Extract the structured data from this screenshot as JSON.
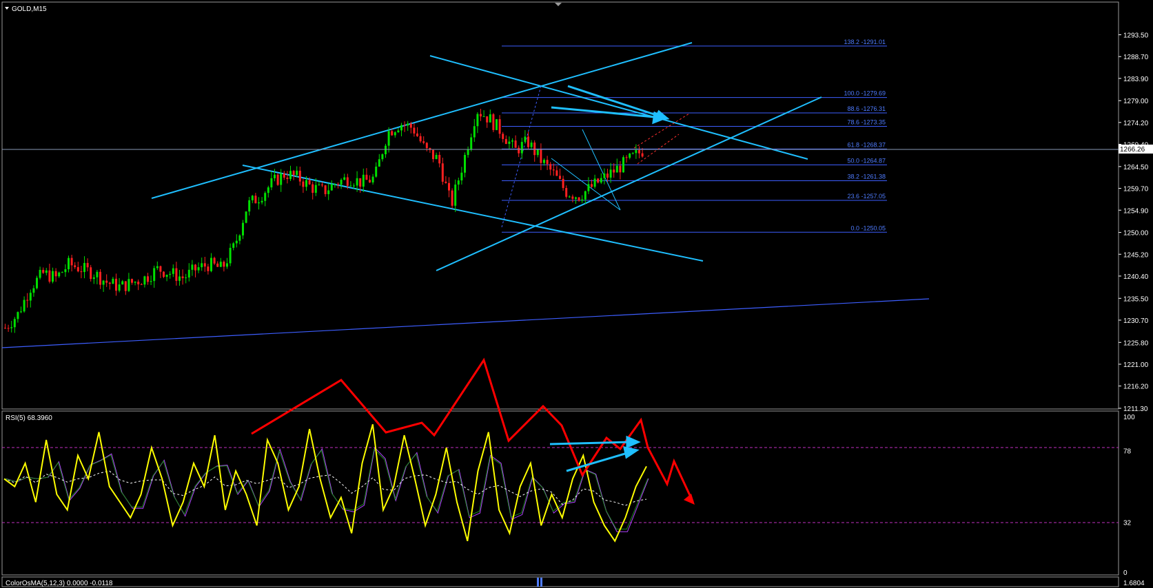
{
  "header": {
    "symbol_label": "GOLD,M15",
    "rsi_label": "RSI(5) 68.3960",
    "osma_label": "ColorOsMA(5,12,3) 0.0000 -0.0118",
    "osma_axis_value": "1.6804"
  },
  "colors": {
    "background": "#000000",
    "bull_candle": "#00e000",
    "bear_candle": "#ff2020",
    "trendline": "#1fbfff",
    "fib": "#4f7cff",
    "rsi": "#ffff00",
    "annotation": "#ff0000",
    "grid_axis": "#ffffff"
  },
  "chart_data": [
    {
      "type": "candlestick",
      "title": "GOLD,M15",
      "ylim": [
        1211.3,
        1296.0
      ],
      "price_ticks": [
        "1293.50",
        "1288.70",
        "1283.90",
        "1279.00",
        "1274.20",
        "1269.40",
        "1264.50",
        "1259.70",
        "1254.90",
        "1250.00",
        "1245.20",
        "1240.40",
        "1235.50",
        "1230.70",
        "1225.80",
        "1221.00",
        "1216.20",
        "1211.30"
      ],
      "current_price": "1266.26",
      "fibonacci_levels": [
        {
          "ratio": "138.2",
          "price": "1291.01"
        },
        {
          "ratio": "100.0",
          "price": "1279.69"
        },
        {
          "ratio": "88.6",
          "price": "1276.31"
        },
        {
          "ratio": "78.6",
          "price": "1273.35"
        },
        {
          "ratio": "61.8",
          "price": "1268.37"
        },
        {
          "ratio": "50.0",
          "price": "1264.87"
        },
        {
          "ratio": "38.2",
          "price": "1261.38"
        },
        {
          "ratio": "23.6",
          "price": "1257.05"
        },
        {
          "ratio": "0.0",
          "price": "1250.05"
        }
      ],
      "fib_labels": [
        "138.2 -1291.01",
        "100.0 -1279.69",
        "88.6 -1276.31",
        "78.6 -1273.35",
        "61.8 -1268.37",
        "50.0 -1264.87",
        "38.2 -1261.38",
        "23.6 -1257.05",
        "0.0 -1250.05"
      ],
      "close_path": [
        1229,
        1232,
        1238,
        1241,
        1240,
        1243,
        1242,
        1241,
        1239,
        1238,
        1239,
        1240,
        1242,
        1241,
        1240,
        1242,
        1243,
        1242,
        1247,
        1256,
        1258,
        1261,
        1263,
        1262,
        1260,
        1259,
        1261,
        1262,
        1261,
        1262,
        1272,
        1274,
        1273,
        1268,
        1266,
        1256,
        1266,
        1277,
        1275,
        1272,
        1268,
        1270,
        1266,
        1263,
        1259,
        1258,
        1260,
        1262,
        1264,
        1266,
        1268
      ]
    },
    {
      "type": "line",
      "title": "RSI(5) 68.3960",
      "ylim": [
        0,
        100
      ],
      "levels": [
        "100",
        "78",
        "32",
        "0"
      ],
      "value": 68.396,
      "series": [
        {
          "values": [
            60,
            55,
            70,
            45,
            85,
            50,
            40,
            75,
            60,
            90,
            55,
            45,
            35,
            50,
            80,
            60,
            30,
            45,
            70,
            55,
            88,
            40,
            65,
            50,
            30,
            85,
            70,
            40,
            55,
            92,
            60,
            35,
            48,
            25,
            70,
            95,
            40,
            55,
            88,
            60,
            30,
            50,
            80,
            45,
            20,
            65,
            90,
            40,
            25,
            55,
            70,
            30,
            50,
            35,
            60,
            75,
            45,
            30,
            20,
            35,
            55,
            68
          ]
        }
      ]
    }
  ]
}
